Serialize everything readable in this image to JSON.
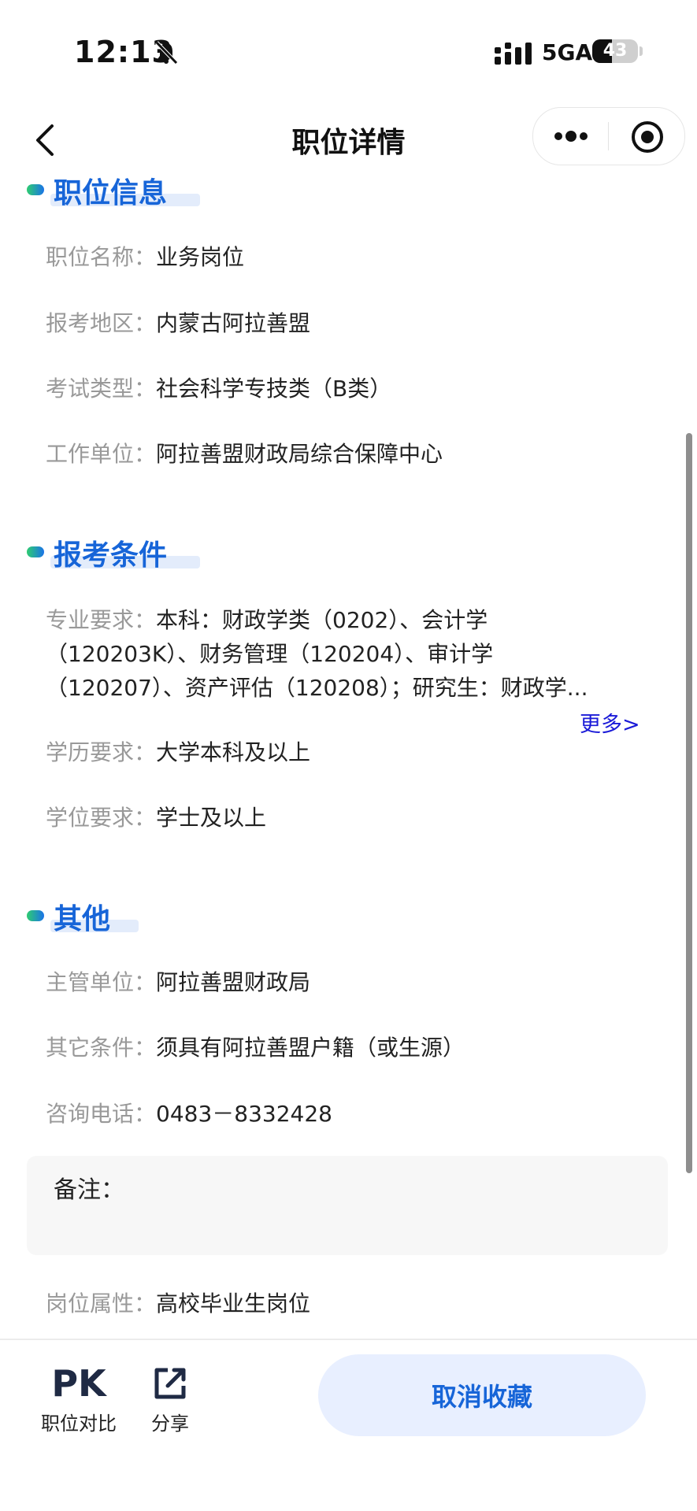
{
  "status_bar": {
    "time": "12:13",
    "network": "5GA",
    "battery": "43",
    "battery_level": 0.43
  },
  "nav": {
    "title": "职位详情"
  },
  "sections": {
    "position_info": {
      "title": "职位信息",
      "rows": [
        {
          "label": "职位名称：",
          "value": "业务岗位"
        },
        {
          "label": "报考地区：",
          "value": "内蒙古阿拉善盟"
        },
        {
          "label": "考试类型：",
          "value": "社会科学专技类（B类）"
        },
        {
          "label": "工作单位：",
          "value": "阿拉善盟财政局综合保障中心"
        }
      ]
    },
    "requirements": {
      "title": "报考条件",
      "major": {
        "label": "专业要求：",
        "value": "本科：财政学类（0202）、会计学（120203K）、财务管理（120204）、审计学（120207）、资产评估（120208）；研究生：财政学..."
      },
      "more": "更多>",
      "rows": [
        {
          "label": "学历要求：",
          "value": "大学本科及以上"
        },
        {
          "label": "学位要求：",
          "value": "学士及以上"
        }
      ]
    },
    "other": {
      "title": "其他",
      "rows": [
        {
          "label": "主管单位：",
          "value": "阿拉善盟财政局"
        },
        {
          "label": "其它条件：",
          "value": "须具有阿拉善盟户籍（或生源）"
        },
        {
          "label": "咨询电话：",
          "value": "0483－8332428"
        }
      ],
      "remark_label": "备注：",
      "attribute": {
        "label": "岗位属性：",
        "value": "高校毕业生岗位"
      }
    }
  },
  "bottom_bar": {
    "compare_icon": "PK",
    "compare_label": "职位对比",
    "share_label": "分享",
    "cancel_favorite": "取消收藏"
  },
  "colors": {
    "accent": "#1765d8",
    "button_bg": "#e8efff",
    "label_gray": "#999999"
  }
}
